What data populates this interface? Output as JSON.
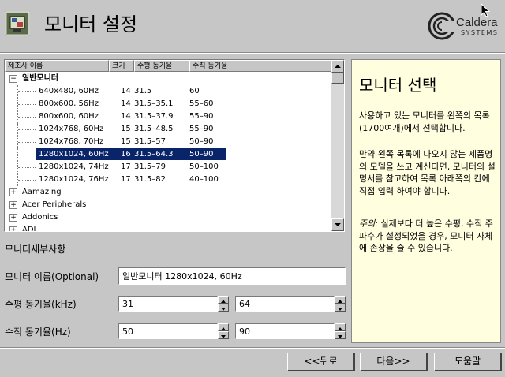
{
  "header": {
    "title": "모니터 설정",
    "logo_text": "Caldera",
    "logo_sub": "SYSTEMS"
  },
  "monitor_list": {
    "columns": [
      "제조사 이름",
      "크기",
      "수평 동기율",
      "수직 동기율"
    ],
    "rows": [
      {
        "type": "group",
        "name": "일반모니터",
        "expanded": true
      },
      {
        "type": "item",
        "name": "640x480, 60Hz",
        "size": "14",
        "hsync": "31.5",
        "vsync": "60"
      },
      {
        "type": "item",
        "name": "800x600, 56Hz",
        "size": "14",
        "hsync": "31.5–35.1",
        "vsync": "55–60"
      },
      {
        "type": "item",
        "name": "800x600, 60Hz",
        "size": "14",
        "hsync": "31.5–37.9",
        "vsync": "55–90"
      },
      {
        "type": "item",
        "name": "1024x768, 60Hz",
        "size": "15",
        "hsync": "31.5–48.5",
        "vsync": "55–90"
      },
      {
        "type": "item",
        "name": "1024x768, 70Hz",
        "size": "15",
        "hsync": "31.5–57",
        "vsync": "50–90"
      },
      {
        "type": "item",
        "name": "1280x1024, 60Hz",
        "size": "16",
        "hsync": "31.5–64.3",
        "vsync": "50–90",
        "selected": true
      },
      {
        "type": "item",
        "name": "1280x1024, 74Hz",
        "size": "17",
        "hsync": "31.5–79",
        "vsync": "50–100"
      },
      {
        "type": "item",
        "name": "1280x1024, 76Hz",
        "size": "17",
        "hsync": "31.5–82",
        "vsync": "40–100"
      },
      {
        "type": "group",
        "name": "Aamazing",
        "expanded": false
      },
      {
        "type": "group",
        "name": "Acer Peripherals",
        "expanded": false
      },
      {
        "type": "group",
        "name": "Addonics",
        "expanded": false
      },
      {
        "type": "group",
        "name": "ADI",
        "expanded": false
      }
    ]
  },
  "help": {
    "title": "모니터 선택",
    "paragraphs": [
      "사용하고 있는 모니터를 왼쪽의 목록(1700여개)에서 선택합니다.",
      "만약 왼쪽 목록에 나오지 않는 제품명의 모델을 쓰고 계신다면, 모니터의 설명서를 참고하여 목록 아래쪽의 칸에 직접 입력 하여야 합니다."
    ],
    "note_label": "주의:",
    "note_text": " 실제보다 더 높은 수평, 수직 주파수가 설정되었을 경우, 모니터 자체에 손상을 줄 수 있습니다."
  },
  "details": {
    "section_label": "모니터세부사항",
    "name_label": "모니터 이름(Optional)",
    "name_value": "일반모니터 1280x1024, 60Hz",
    "hsync_label": "수평 동기율(kHz)",
    "hsync_min": "31",
    "hsync_max": "64",
    "vsync_label": "수직 동기율(Hz)",
    "vsync_min": "50",
    "vsync_max": "90"
  },
  "buttons": {
    "back": "<<뒤로",
    "next": "다음>>",
    "help": "도움말"
  }
}
